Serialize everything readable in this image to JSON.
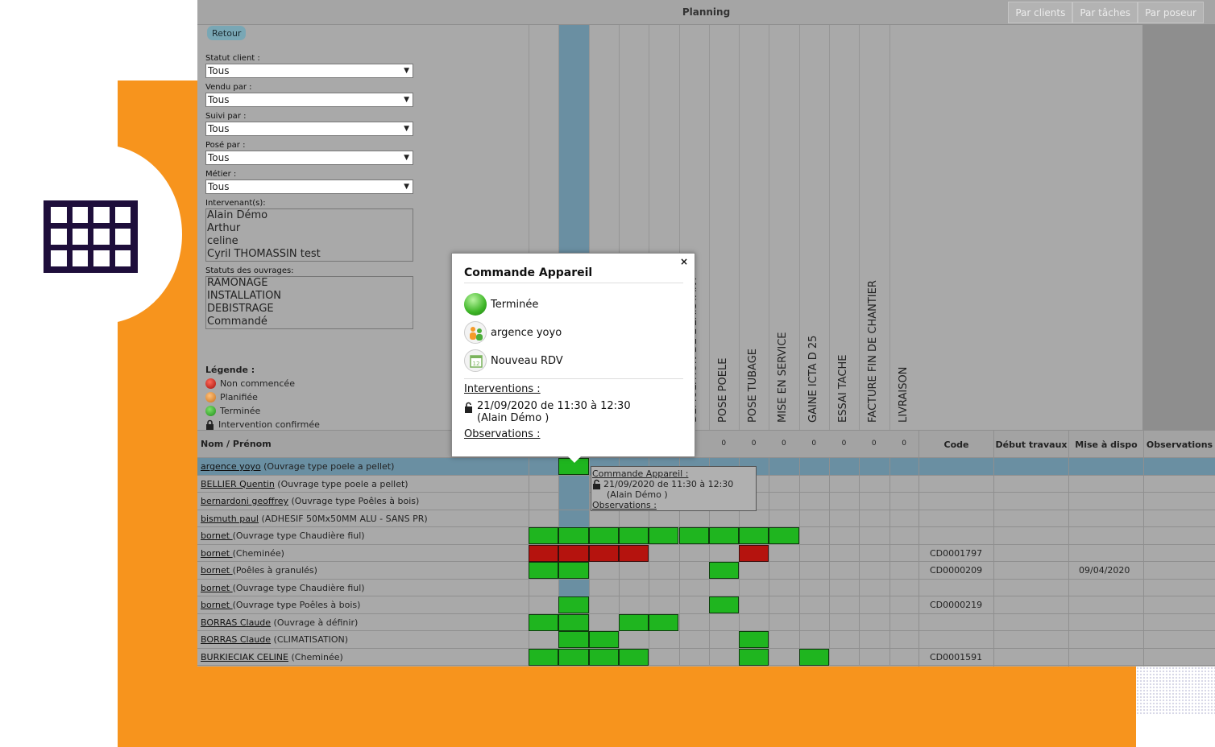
{
  "app": {
    "title": "Planning"
  },
  "view_tabs": [
    "Par clients",
    "Par tâches",
    "Par poseur"
  ],
  "back_label": "Retour",
  "filters": [
    {
      "label": "Statut client :",
      "value": "Tous"
    },
    {
      "label": "Vendu par :",
      "value": "Tous"
    },
    {
      "label": "Suivi par :",
      "value": "Tous"
    },
    {
      "label": "Posé par :",
      "value": "Tous"
    },
    {
      "label": "Métier :",
      "value": "Tous"
    }
  ],
  "intervenants": {
    "label": "Intervenant(s):",
    "items": [
      "Alain Démo",
      "Arthur",
      "celine",
      "Cyril THOMASSIN test"
    ]
  },
  "statuts": {
    "label": "Statuts des ouvrages:",
    "items": [
      "RAMONAGE",
      "INSTALLATION",
      "DEBISTRAGE",
      "Commandé"
    ]
  },
  "legend": {
    "title": "Légende :",
    "items": [
      "Non commencée",
      "Planifiée",
      "Terminée",
      "Intervention confirmée"
    ]
  },
  "task_columns": [
    {
      "name": "",
      "count": ""
    },
    {
      "name": "",
      "count": ""
    },
    {
      "name": "",
      "count": ""
    },
    {
      "name": "",
      "count": ""
    },
    {
      "name": "",
      "count": ""
    },
    {
      "name": "DEMOLITION DE L'EXISTANT",
      "count": ""
    },
    {
      "name": "POSE POELE",
      "count": "0"
    },
    {
      "name": "POSE TUBAGE",
      "count": "0"
    },
    {
      "name": "MISE EN SERVICE",
      "count": "0"
    },
    {
      "name": "GAINE ICTA D 25",
      "count": "0"
    },
    {
      "name": "ESSAI TACHE",
      "count": "0"
    },
    {
      "name": "FACTURE FIN DE CHANTIER",
      "count": "0"
    },
    {
      "name": "LIVRAISON",
      "count": "0"
    }
  ],
  "header": {
    "name": "Nom / Prénom",
    "code": "Code",
    "debut": "Début travaux",
    "mise": "Mise à dispo",
    "obs": "Observations"
  },
  "rows": [
    {
      "link": "argence yoyo",
      "desc": " (Ouvrage type poele a pellet)",
      "cells": "-g-----------",
      "code": "",
      "mise": ""
    },
    {
      "link": "BELLIER Quentin",
      "desc": " (Ouvrage type poele a pellet)",
      "cells": "-------------",
      "code": "",
      "mise": ""
    },
    {
      "link": "bernardoni geoffrey",
      "desc": " (Ouvrage type Poêles à bois)",
      "cells": "-------------",
      "code": "",
      "mise": ""
    },
    {
      "link": "bismuth paul",
      "desc": " (ADHESIF 50Mx50MM ALU - SANS PR)",
      "cells": "-------------",
      "code": "",
      "mise": ""
    },
    {
      "link": "bornet ",
      "desc": "(Ouvrage type Chaudière fiul)",
      "cells": "ggggggggg----",
      "code": "",
      "mise": ""
    },
    {
      "link": "bornet ",
      "desc": "(Cheminée)",
      "cells": "rrrr---r-----",
      "code": "CD0001797",
      "mise": ""
    },
    {
      "link": "bornet ",
      "desc": "(Poêles à granulés)",
      "cells": "gg----g------",
      "code": "CD0000209",
      "mise": "09/04/2020"
    },
    {
      "link": "bornet ",
      "desc": "(Ouvrage type Chaudière fiul)",
      "cells": "-------------",
      "code": "",
      "mise": ""
    },
    {
      "link": "bornet ",
      "desc": "(Ouvrage type Poêles à bois)",
      "cells": "-g----g------",
      "code": "CD0000219",
      "mise": ""
    },
    {
      "link": "BORRAS Claude",
      "desc": " (Ouvrage à définir)",
      "cells": "gg-gg--------",
      "code": "",
      "mise": ""
    },
    {
      "link": "BORRAS Claude",
      "desc": " (CLIMATISATION)",
      "cells": "-gg----g-----",
      "code": "",
      "mise": ""
    },
    {
      "link": "BURKIECIAK CELINE",
      "desc": " (Cheminée)",
      "cells": "gggg---g-g---",
      "code": "CD0001591",
      "mise": ""
    }
  ],
  "popup": {
    "title": "Commande Appareil",
    "close": "×",
    "status": "Terminée",
    "person": "argence yoyo",
    "rdv": "Nouveau RDV",
    "interventions_label": "Interventions :",
    "intervention_date": "21/09/2020 de 11:30 à 12:30",
    "intervention_who": "(Alain Démo )",
    "observations_label": "Observations :"
  },
  "tooltip": {
    "title": "Commande Appareil :",
    "date": "21/09/2020 de 11:30 à 12:30",
    "who": "(Alain Démo )",
    "observations_label": "Observations :"
  },
  "icons": {
    "app_logo": "calendar-grid-icon",
    "lock": "lock-icon",
    "close": "close-icon",
    "status": "green-ball-icon",
    "person": "people-icon",
    "rdv": "calendar-day-icon"
  },
  "colors": {
    "orange": "#f7941d",
    "navy": "#1e0e3b",
    "highlight": "#6a8fa2",
    "done": "#1fb51f",
    "not_started": "#b5130e"
  }
}
